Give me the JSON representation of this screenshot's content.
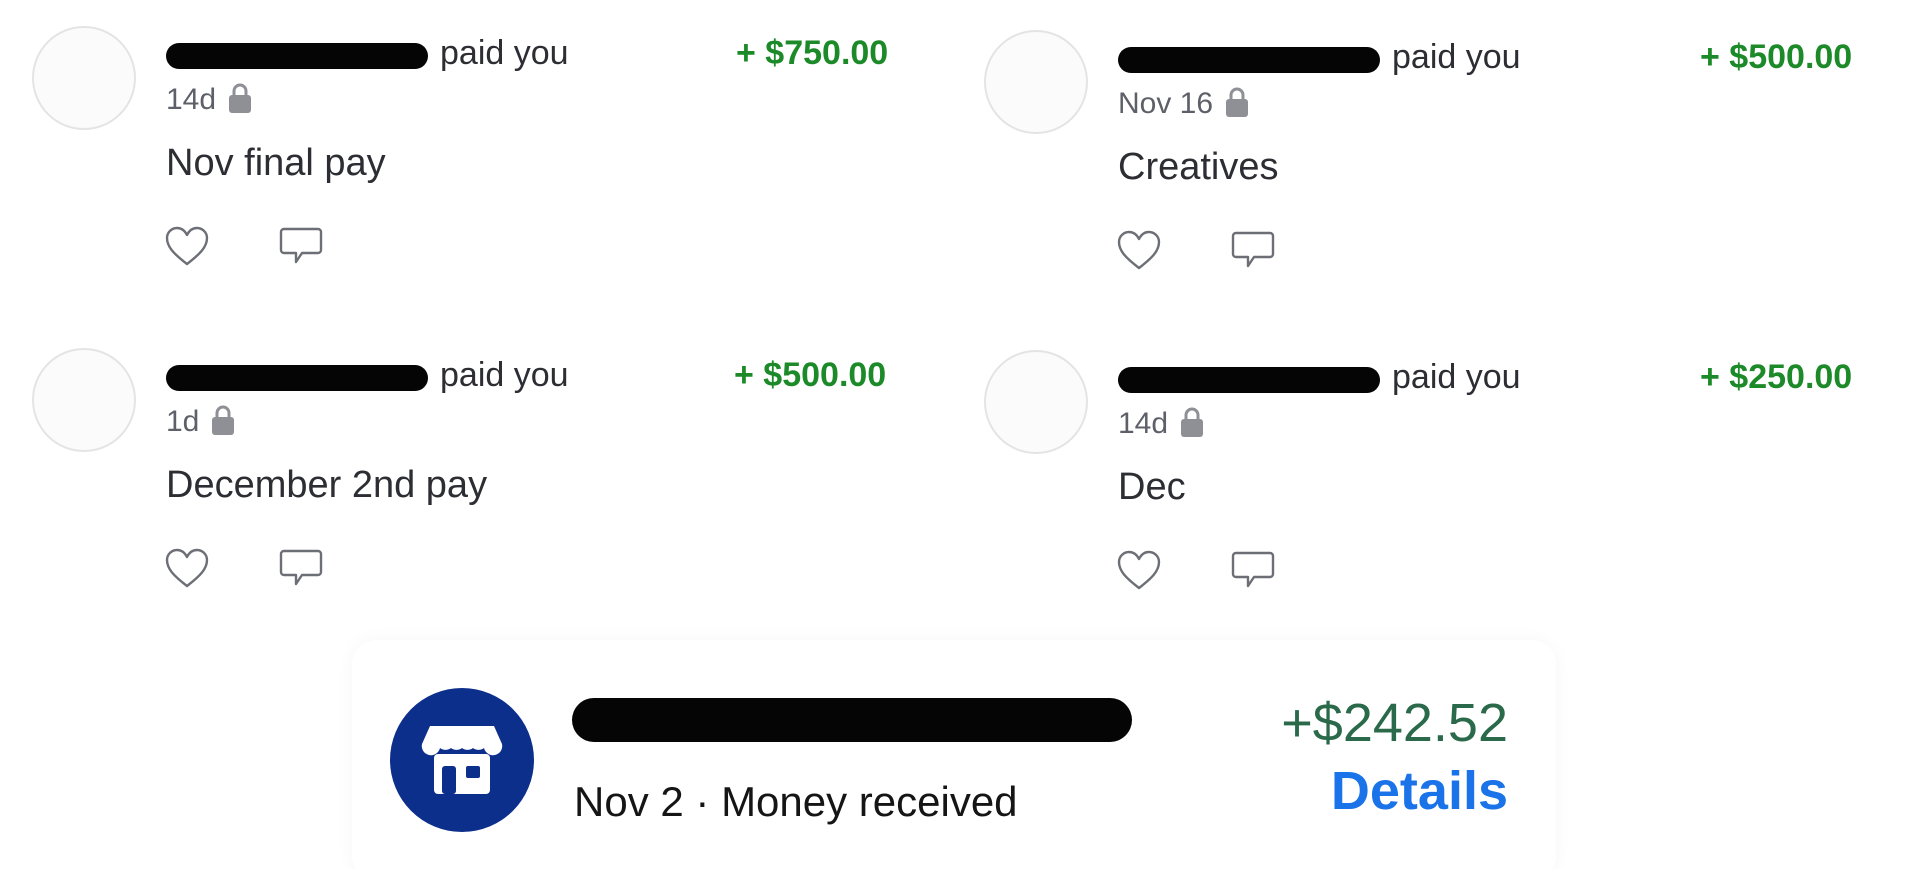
{
  "transactions": [
    {
      "headline_suffix": "paid you",
      "amount": "+ $750.00",
      "date": "14d",
      "note": "Nov final pay"
    },
    {
      "headline_suffix": "paid you",
      "amount": "+ $500.00",
      "date": "Nov 16",
      "note": "Creatives"
    },
    {
      "headline_suffix": "paid you",
      "amount": "+ $500.00",
      "date": "1d",
      "note": "December 2nd pay"
    },
    {
      "headline_suffix": "paid you",
      "amount": "+ $250.00",
      "date": "14d",
      "note": "Dec"
    }
  ],
  "deposit_card": {
    "amount": "+$242.52",
    "date": "Nov 2",
    "separator": "·",
    "status": "Money received",
    "details_label": "Details"
  },
  "colors": {
    "positive_amount": "#1d8a2a",
    "card_amount": "#2a6a4a",
    "link_blue": "#1a73e8",
    "store_badge": "#0d2f8c"
  },
  "icons": {
    "privacy": "lock-icon",
    "like": "heart-icon",
    "comment": "comment-icon",
    "merchant": "storefront-icon"
  }
}
